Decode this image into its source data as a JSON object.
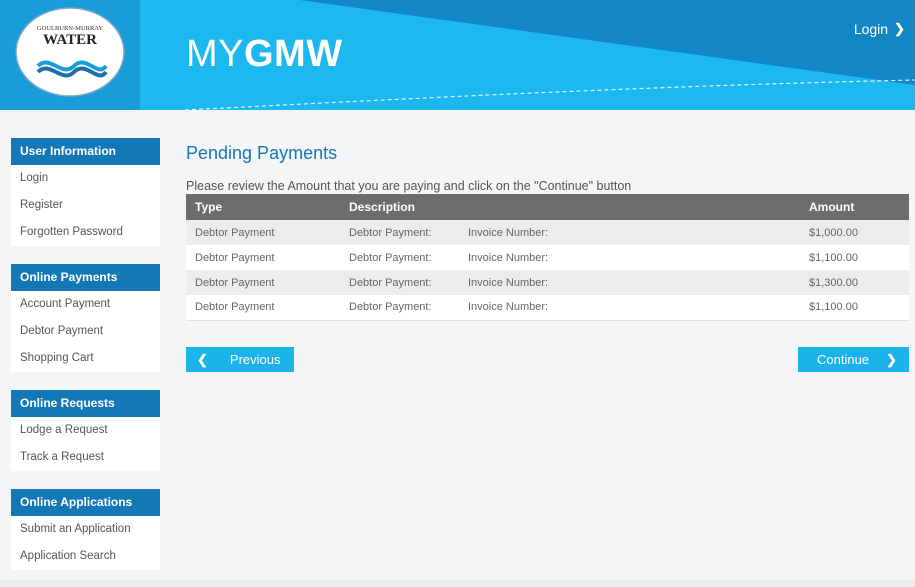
{
  "header": {
    "logo": {
      "line1": "GOULBURN-MURRAY",
      "line2": "WATER"
    },
    "brand_light": "MY",
    "brand_bold": "GMW",
    "login_label": "Login",
    "login_icon": "chevron-right-icon"
  },
  "sidebar": {
    "groups": [
      {
        "title": "User Information",
        "items": [
          "Login",
          "Register",
          "Forgotten Password"
        ]
      },
      {
        "title": "Online Payments",
        "items": [
          "Account Payment",
          "Debtor Payment",
          "Shopping Cart"
        ]
      },
      {
        "title": "Online Requests",
        "items": [
          "Lodge a Request",
          "Track a Request"
        ]
      },
      {
        "title": "Online Applications",
        "items": [
          "Submit an Application",
          "Application Search"
        ]
      }
    ]
  },
  "main": {
    "title": "Pending Payments",
    "intro": "Please review the Amount that you are paying and click on the \"Continue\" button",
    "table": {
      "headers": [
        "Type",
        "Description",
        "",
        "Amount"
      ],
      "rows": [
        [
          "Debtor Payment",
          "Debtor Payment:",
          "Invoice Number:",
          "$1,000.00"
        ],
        [
          "Debtor Payment",
          "Debtor Payment:",
          "Invoice Number:",
          "$1,100.00"
        ],
        [
          "Debtor Payment",
          "Debtor Payment:",
          "Invoice Number:",
          "$1,300.00"
        ],
        [
          "Debtor Payment",
          "Debtor Payment:",
          "Invoice Number:",
          "$1,100.00"
        ]
      ]
    },
    "previous_label": "Previous",
    "continue_label": "Continue"
  },
  "colors": {
    "header_blue": "#1a9cd8",
    "header_light": "#1cb2ea",
    "sidebar_head": "#1478b6",
    "button": "#1cb2ea",
    "table_head": "#6d6d6d"
  }
}
